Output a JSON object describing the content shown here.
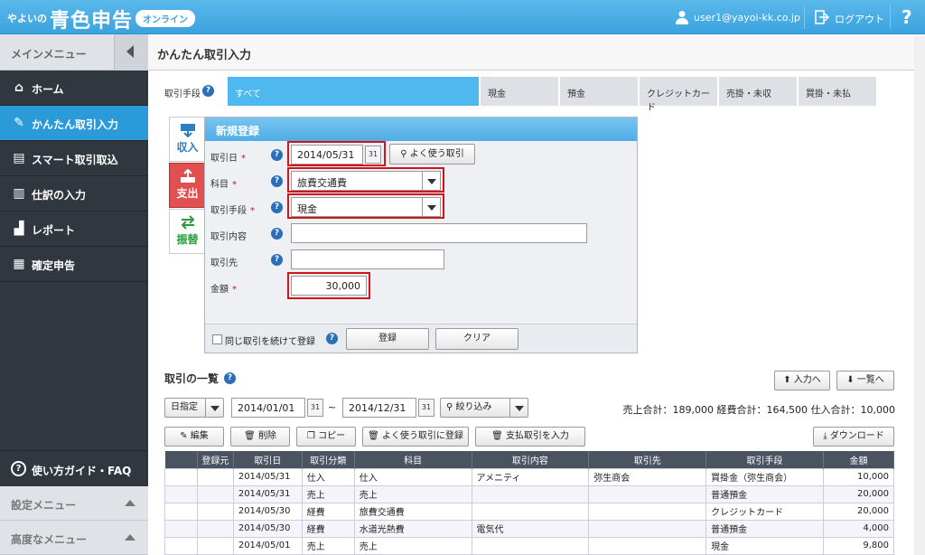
{
  "header": {
    "logo_small": "やよいの",
    "logo_big": "青色申告",
    "badge": "オンライン",
    "user": "user1@yayoi-kk.co.jp",
    "logout": "ログアウト",
    "help": "?"
  },
  "sidebar": {
    "menu_title": "メインメニュー",
    "items": [
      {
        "label": "ホーム",
        "icon": "home-icon"
      },
      {
        "label": "かんたん取引入力",
        "icon": "pencil-icon"
      },
      {
        "label": "スマート取引取込",
        "icon": "import-icon"
      },
      {
        "label": "仕訳の入力",
        "icon": "book-icon"
      },
      {
        "label": "レポート",
        "icon": "chart-icon"
      },
      {
        "label": "確定申告",
        "icon": "calculator-icon"
      }
    ],
    "faq": "使い方ガイド・FAQ",
    "settings": "設定メニュー",
    "advanced": "高度なメニュー"
  },
  "page": {
    "title": "かんたん取引入力"
  },
  "methods": {
    "label": "取引手段",
    "tabs": [
      "すべて",
      "現金",
      "預金",
      "クレジットカード",
      "売掛・未収",
      "買掛・未払"
    ]
  },
  "types": {
    "income": "収入",
    "expense": "支出",
    "transfer": "振替"
  },
  "form": {
    "title": "新規登録",
    "date_label": "取引日",
    "date": "2014/05/31",
    "fav_btn": "よく使う取引",
    "account_label": "科目",
    "account": "旅費交通費",
    "method_label": "取引手段",
    "method": "現金",
    "content_label": "取引内容",
    "content": "",
    "partner_label": "取引先",
    "partner": "",
    "amount_label": "金額",
    "amount": "30,000",
    "repeat_label": "同じ取引を続けて登録",
    "register": "登録",
    "clear": "クリア",
    "req": "*"
  },
  "list": {
    "title": "取引の一覧",
    "in_btn": "入力へ",
    "list_btn": "一覧へ",
    "date_mode": "日指定",
    "from": "2014/01/01",
    "tilde": "~",
    "to": "2014/12/31",
    "filter": "絞り込み",
    "totals": "売上合計：189,000 経費合計：164,500 仕入合計：10,000",
    "actions": {
      "edit": "編集",
      "delete": "削除",
      "copy": "コピー",
      "fav": "よく使う取引に登録",
      "pay": "支払取引を入力",
      "download": "ダウンロード"
    },
    "columns": [
      "",
      "登録元",
      "取引日",
      "取引分類",
      "科目",
      "取引内容",
      "取引先",
      "取引手段",
      "金額"
    ],
    "rows": [
      [
        "",
        "",
        "2014/05/31",
        "仕入",
        "仕入",
        "アメニティ",
        "弥生商会",
        "買掛金（弥生商会）",
        "10,000"
      ],
      [
        "",
        "",
        "2014/05/31",
        "売上",
        "売上",
        "",
        "",
        "普通預金",
        "20,000"
      ],
      [
        "",
        "",
        "2014/05/30",
        "経費",
        "旅費交通費",
        "",
        "",
        "クレジットカード",
        "20,000"
      ],
      [
        "",
        "",
        "2014/05/30",
        "経費",
        "水道光熱費",
        "電気代",
        "",
        "普通預金",
        "4,000"
      ],
      [
        "",
        "",
        "2014/05/01",
        "売上",
        "売上",
        "",
        "",
        "現金",
        "9,800"
      ]
    ]
  }
}
